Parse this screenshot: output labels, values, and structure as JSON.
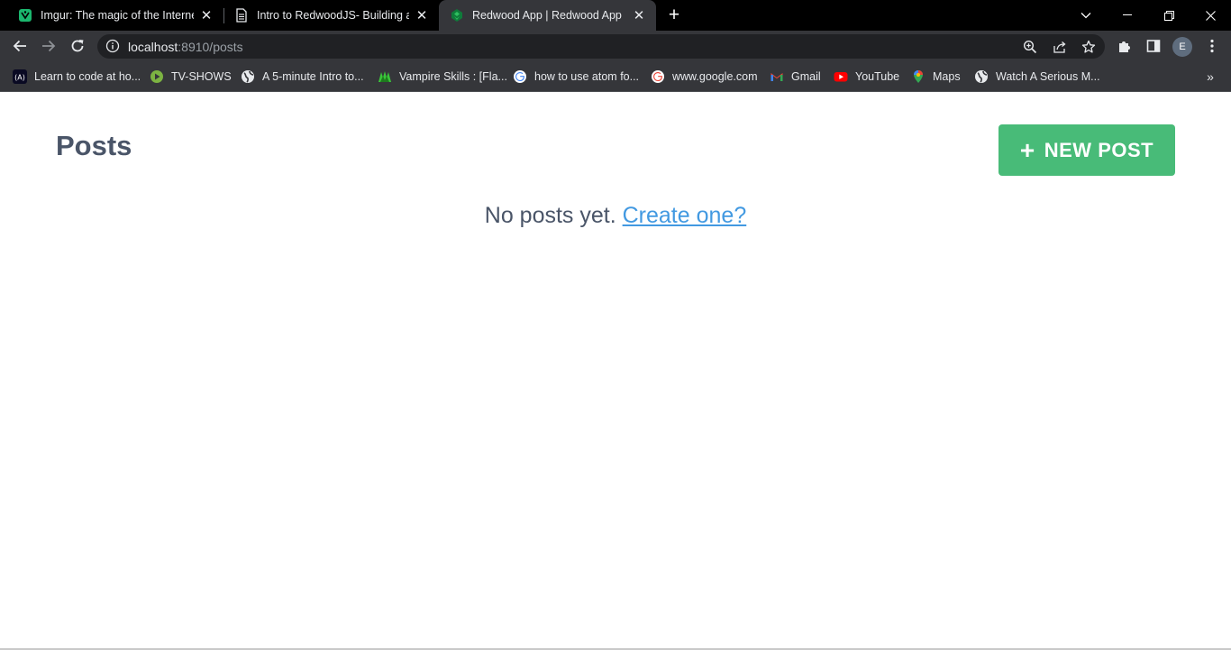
{
  "browser": {
    "tabs": [
      {
        "title": "Imgur: The magic of the Internet",
        "active": false,
        "icon": "imgur-icon"
      },
      {
        "title": "Intro to RedwoodJS- Building a D",
        "active": false,
        "icon": "document-icon"
      },
      {
        "title": "Redwood App | Redwood App",
        "active": true,
        "icon": "redwood-icon"
      }
    ],
    "tab_close_glyph": "✕",
    "new_tab_glyph": "+",
    "address": {
      "host": "localhost",
      "rest": ":8910/posts"
    },
    "profile_initial": "E",
    "bookmarks": [
      {
        "label": "Learn to code at ho...",
        "icon": "freecodecamp-icon"
      },
      {
        "label": "TV-SHOWS",
        "icon": "play-circle-icon"
      },
      {
        "label": "A 5-minute Intro to...",
        "icon": "globe-icon"
      },
      {
        "label": "Vampire Skills : [Fla...",
        "icon": "vampire-icon"
      },
      {
        "label": "how to use atom fo...",
        "icon": "google-icon"
      },
      {
        "label": "www.google.com",
        "icon": "google-icon"
      },
      {
        "label": "Gmail",
        "icon": "gmail-icon"
      },
      {
        "label": "YouTube",
        "icon": "youtube-icon"
      },
      {
        "label": "Maps",
        "icon": "maps-icon"
      },
      {
        "label": "Watch A Serious M...",
        "icon": "globe-icon"
      }
    ],
    "bookmarks_more_glyph": "»"
  },
  "page": {
    "title": "Posts",
    "new_post_icon": "+",
    "new_post_label": "NEW POST",
    "empty_text": "No posts yet.",
    "create_link": "Create one?"
  },
  "colors": {
    "accent_green": "#48bb78",
    "link_blue": "#4299e1",
    "heading_gray": "#4a5568",
    "chrome_dark": "#35363a"
  }
}
